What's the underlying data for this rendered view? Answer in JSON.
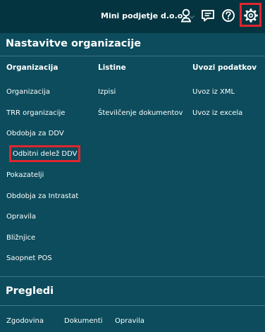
{
  "topbar": {
    "company": "Mini podjetje d.o.o.",
    "icons": [
      "user-icon",
      "messages-icon",
      "help-icon",
      "settings-icon"
    ]
  },
  "settings_menu": {
    "title": "Nastavitve organizacije",
    "columns": [
      {
        "header": "Organizacija",
        "items": [
          "Organizacija",
          "TRR organizacije",
          "Obdobja za DDV",
          "Odbitni delež DDV",
          "Pokazatelji",
          "Obdobja za Intrastat",
          "Opravila",
          "Bližnjice",
          "Saopnet POS"
        ]
      },
      {
        "header": "Listine",
        "items": [
          "Izpisi",
          "Številčenje dokumentov"
        ]
      },
      {
        "header": "Uvozi podatkov",
        "items": [
          "Uvoz iz XML",
          "Uvoz iz excela"
        ]
      }
    ]
  },
  "overviews": {
    "title": "Pregledi",
    "items": [
      "Zgodovina",
      "Dokumenti",
      "Opravila"
    ]
  },
  "colors": {
    "topbar": "#04343f",
    "panel": "#0c4c5c",
    "highlight": "#e0262f"
  }
}
